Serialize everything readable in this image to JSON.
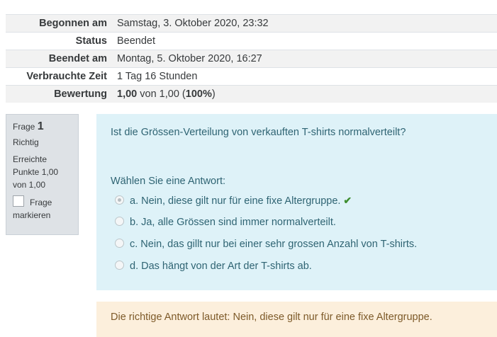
{
  "summary": {
    "rows": [
      {
        "label": "Begonnen am",
        "value": "Samstag, 3. Oktober 2020, 23:32"
      },
      {
        "label": "Status",
        "value": "Beendet"
      },
      {
        "label": "Beendet am",
        "value": "Montag, 5. Oktober 2020, 16:27"
      },
      {
        "label": "Verbrauchte Zeit",
        "value": "1 Tag 16 Stunden"
      }
    ],
    "grade_label": "Bewertung",
    "grade_score": "1,00",
    "grade_of": " von 1,00 (",
    "grade_percent": "100%",
    "grade_close": ")"
  },
  "question": {
    "frage_label": "Frage",
    "number": "1",
    "state": "Richtig",
    "grade": "Erreichte Punkte 1,00 von 1,00",
    "flag_label": "Frage markieren",
    "text": "Ist die Grössen-Verteilung von verkauften T-shirts normalverteilt?",
    "prompt": "Wählen Sie eine Antwort:",
    "options": [
      {
        "label": "a. Nein, diese gilt nur für eine fixe Altergruppe.",
        "checked": true,
        "correct": true
      },
      {
        "label": "b. Ja, alle Grössen sind immer normalverteilt.",
        "checked": false
      },
      {
        "label": "c. Nein, das gillt nur bei einer sehr grossen Anzahl von T-shirts.",
        "checked": false
      },
      {
        "label": "d. Das hängt von der Art der T-shirts ab.",
        "checked": false
      }
    ],
    "correct_icon": "check-icon",
    "feedback": "Die richtige Antwort lautet: Nein, diese gilt nur für eine fixe Altergruppe."
  },
  "colors": {
    "formulation_bg": "#def2f8",
    "feedback_bg": "#fcefdc",
    "correct": "#3e8e2f"
  }
}
